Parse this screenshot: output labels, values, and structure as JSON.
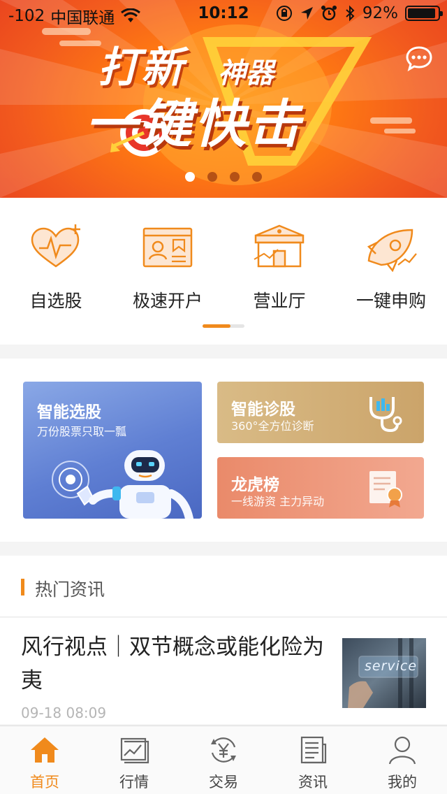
{
  "status_bar": {
    "signal": "-102",
    "carrier": "中国联通",
    "time": "10:12",
    "battery_text": "92%",
    "battery_level": 0.92
  },
  "banner": {
    "title_line1_a": "打新",
    "title_line1_b": "神器",
    "title_line2": "一键快击",
    "slide_count": 4,
    "active_slide": 0,
    "colors": {
      "start": "#ff9a1a",
      "end": "#e8421f"
    }
  },
  "quick_menu": {
    "items": [
      {
        "label": "自选股",
        "icon": "heart-chart-icon"
      },
      {
        "label": "极速开户",
        "icon": "id-card-icon"
      },
      {
        "label": "营业厅",
        "icon": "storefront-icon"
      },
      {
        "label": "一键申购",
        "icon": "rocket-icon"
      }
    ],
    "page_index": 0,
    "page_count": 2
  },
  "features": {
    "smart_pick": {
      "title": "智能选股",
      "subtitle": "万份股票只取一瓢"
    },
    "diagnosis": {
      "title": "智能诊股",
      "subtitle": "360°全方位诊断"
    },
    "dragon_tiger": {
      "title": "龙虎榜",
      "subtitle": "一线游资 主力异动"
    }
  },
  "news": {
    "section_title": "热门资讯",
    "items": [
      {
        "headline": "风行视点｜双节概念或能化险为夷",
        "time": "09-18  08:09",
        "thumb_text": "service"
      }
    ]
  },
  "tabbar": {
    "accent": "#f08a1c",
    "items": [
      {
        "label": "首页",
        "icon": "home-icon",
        "active": true
      },
      {
        "label": "行情",
        "icon": "chart-icon",
        "active": false
      },
      {
        "label": "交易",
        "icon": "yen-exchange-icon",
        "active": false
      },
      {
        "label": "资讯",
        "icon": "news-icon",
        "active": false
      },
      {
        "label": "我的",
        "icon": "user-icon",
        "active": false
      }
    ]
  }
}
